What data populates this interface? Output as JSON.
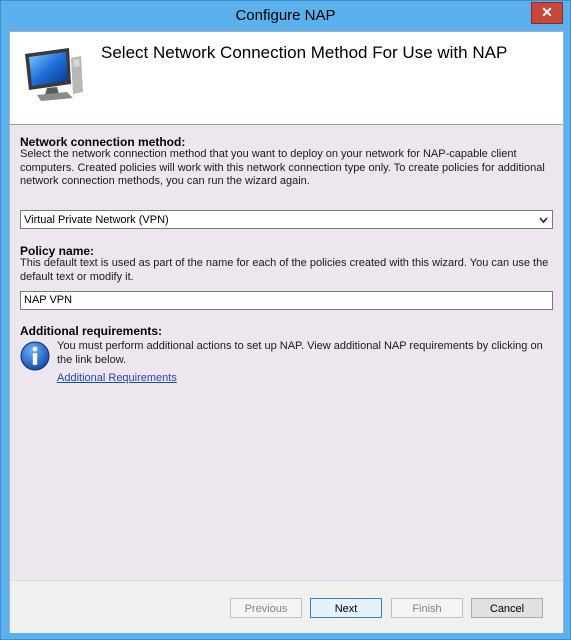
{
  "window": {
    "title": "Configure NAP",
    "close_glyph": "✕"
  },
  "header": {
    "title": "Select Network Connection Method For Use with NAP",
    "icon": "computer-monitor-icon"
  },
  "connection_method": {
    "label": "Network connection method:",
    "description": "Select the network connection method that you want to deploy on your network for NAP-capable client computers. Created policies will work with this network connection type only. To create policies for additional network connection methods, you can run the wizard again.",
    "selected": "Virtual Private Network (VPN)"
  },
  "policy_name": {
    "label": "Policy name:",
    "description": "This default text is used as part of the name for each of the policies created with this wizard. You can use the default text or modify it.",
    "value": "NAP VPN"
  },
  "additional": {
    "label": "Additional requirements:",
    "text": "You must perform additional actions to set up NAP. View additional NAP requirements by clicking on the link below.",
    "link": "Additional Requirements",
    "icon": "info-icon"
  },
  "buttons": {
    "previous": "Previous",
    "next": "Next",
    "finish": "Finish",
    "cancel": "Cancel"
  }
}
